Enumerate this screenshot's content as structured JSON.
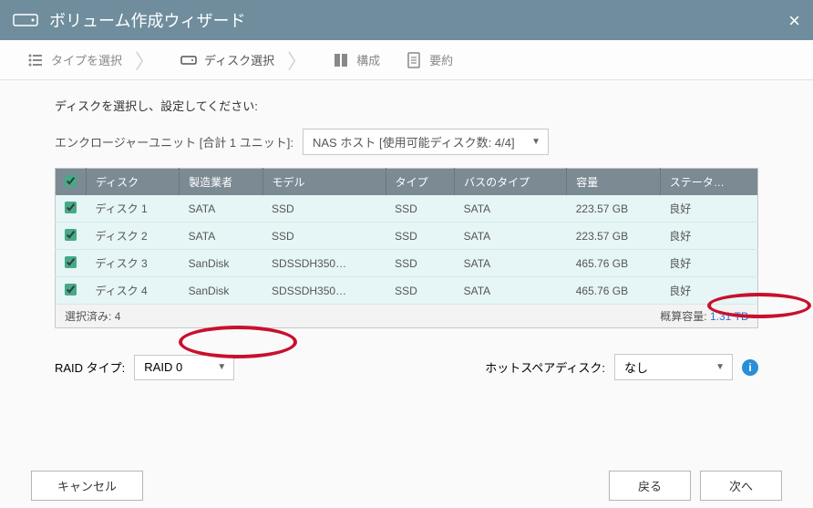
{
  "titlebar": {
    "title": "ボリューム作成ウィザード"
  },
  "steps": {
    "s1": "タイプを選択",
    "s2": "ディスク選択",
    "s3": "構成",
    "s4": "要約"
  },
  "instruction": "ディスクを選択し、設定してください:",
  "enclosure": {
    "label": "エンクロージャーユニット [合計 1 ユニット]:",
    "selected": "NAS ホスト [使用可能ディスク数: 4/4]"
  },
  "columns": {
    "disk": "ディスク",
    "maker": "製造業者",
    "model": "モデル",
    "type": "タイプ",
    "bus": "バスのタイプ",
    "capacity": "容量",
    "status": "ステータ…"
  },
  "rows": [
    {
      "disk": "ディスク 1",
      "maker": "SATA",
      "model": "SSD",
      "type": "SSD",
      "bus": "SATA",
      "capacity": "223.57 GB",
      "status": "良好"
    },
    {
      "disk": "ディスク 2",
      "maker": "SATA",
      "model": "SSD",
      "type": "SSD",
      "bus": "SATA",
      "capacity": "223.57 GB",
      "status": "良好"
    },
    {
      "disk": "ディスク 3",
      "maker": "SanDisk",
      "model": "SDSSDH350…",
      "type": "SSD",
      "bus": "SATA",
      "capacity": "465.76 GB",
      "status": "良好"
    },
    {
      "disk": "ディスク 4",
      "maker": "SanDisk",
      "model": "SDSSDH350…",
      "type": "SSD",
      "bus": "SATA",
      "capacity": "465.76 GB",
      "status": "良好"
    }
  ],
  "footer": {
    "selected_label": "選択済み:",
    "selected_count": "4",
    "capacity_label": "概算容量:",
    "capacity_value": "1.31 TB"
  },
  "raid": {
    "type_label": "RAID タイプ:",
    "type_value": "RAID 0",
    "hotspare_label": "ホットスペアディスク:",
    "hotspare_value": "なし"
  },
  "buttons": {
    "cancel": "キャンセル",
    "back": "戻る",
    "next": "次へ"
  }
}
